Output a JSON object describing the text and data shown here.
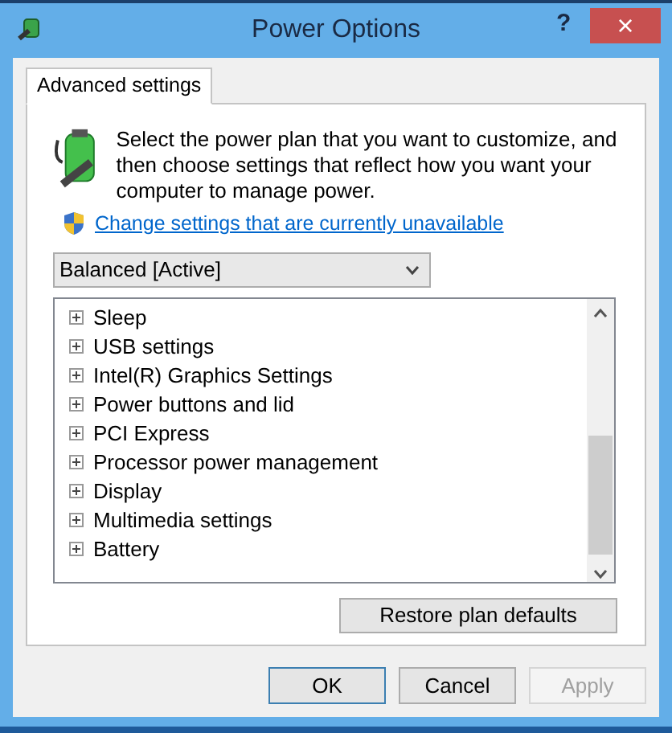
{
  "window": {
    "title": "Power Options",
    "help": "?",
    "close": "×"
  },
  "tabs": [
    {
      "label": "Advanced settings",
      "selected": true
    }
  ],
  "description": "Select the power plan that you want to customize, and then choose settings that reflect how you want your computer to manage power.",
  "link": "Change settings that are currently unavailable",
  "plan_dropdown": {
    "value": "Balanced [Active]"
  },
  "settings_tree": [
    {
      "label": "Sleep",
      "expanded": false
    },
    {
      "label": "USB settings",
      "expanded": false
    },
    {
      "label": "Intel(R) Graphics Settings",
      "expanded": false
    },
    {
      "label": "Power buttons and lid",
      "expanded": false
    },
    {
      "label": "PCI Express",
      "expanded": false
    },
    {
      "label": "Processor power management",
      "expanded": false
    },
    {
      "label": "Display",
      "expanded": false
    },
    {
      "label": "Multimedia settings",
      "expanded": false
    },
    {
      "label": "Battery",
      "expanded": false
    }
  ],
  "restore_button": "Restore plan defaults",
  "buttons": [
    {
      "label": "OK",
      "disabled": false,
      "default": true
    },
    {
      "label": "Cancel",
      "disabled": false,
      "default": false
    },
    {
      "label": "Apply",
      "disabled": true,
      "default": false
    }
  ]
}
